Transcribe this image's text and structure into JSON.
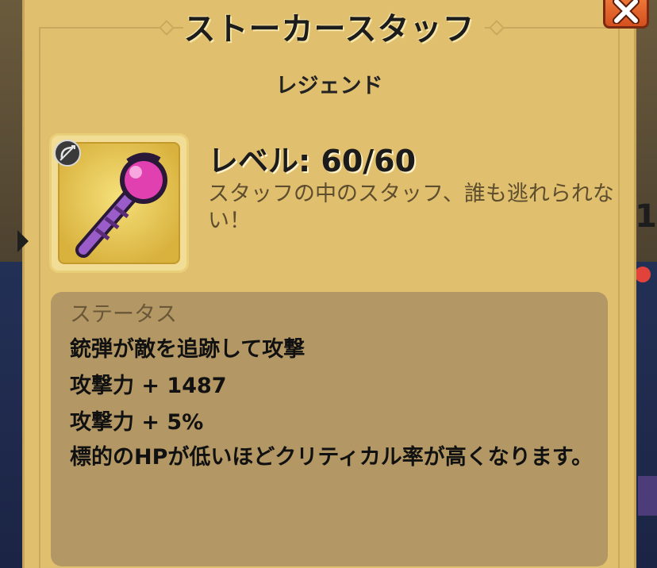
{
  "dialog": {
    "title": "ストーカースタッフ",
    "rarity": "レジェンド",
    "close_icon": "close-icon"
  },
  "item": {
    "icon": "staff-icon",
    "weapon_type_icon": "bow-icon",
    "level": "レベル: 60/60",
    "description": "スタッフの中のスタッフ、誰も逃れられない！"
  },
  "stats": {
    "title": "ステータス",
    "lines": [
      "銃弾が敵を追跡して攻撃",
      "攻撃力 + 1487",
      "攻撃力 + 5%",
      "標的のHPが低いほどクリティカル率が高くなります。"
    ]
  },
  "background": {
    "right_digit": "1"
  },
  "colors": {
    "panel": "#e0bf6f",
    "stats_box": "#b39865",
    "close_button": "#e5622a",
    "staff_orb": "#e040b0",
    "staff_shaft": "#9a5cc8"
  }
}
